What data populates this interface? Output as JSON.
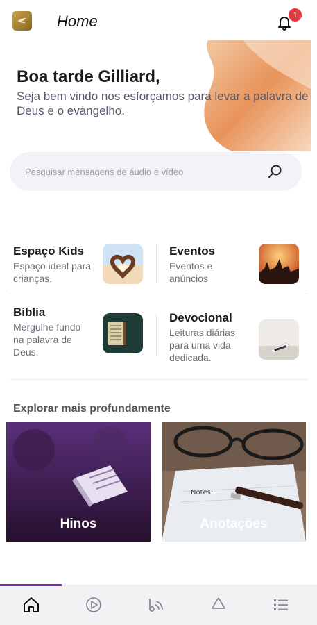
{
  "header": {
    "title": "Home",
    "notification_count": "1"
  },
  "hero": {
    "greeting": "Boa tarde Gilliard,",
    "subtitle": "Seja bem vindo nos esforçamos para levar a palavra de Deus e o evangelho."
  },
  "search": {
    "placeholder": "Pesquisar mensagens de áudio e vídeo"
  },
  "features": [
    {
      "title": "Espaço Kids",
      "description": "Espaço ideal para crianças."
    },
    {
      "title": "Eventos",
      "description": "Eventos e anúncios"
    },
    {
      "title": "Bíblia",
      "description": "Mergulhe fundo na palavra de Deus."
    },
    {
      "title": "Devocional",
      "description": "Leituras diárias para uma vida dedicada."
    }
  ],
  "explore": {
    "title": "Explorar mais profundamente",
    "cards": [
      {
        "label": "Hinos"
      },
      {
        "label": "Anotações"
      }
    ]
  },
  "bottom_nav": {
    "items": [
      "home-icon",
      "play-circle-icon",
      "broadcast-icon",
      "recycle-icon",
      "list-icon"
    ],
    "active_index": 0
  },
  "colors": {
    "accent": "#7b2fb5",
    "hero_orange": "#e8935a",
    "badge": "#e8373f"
  }
}
